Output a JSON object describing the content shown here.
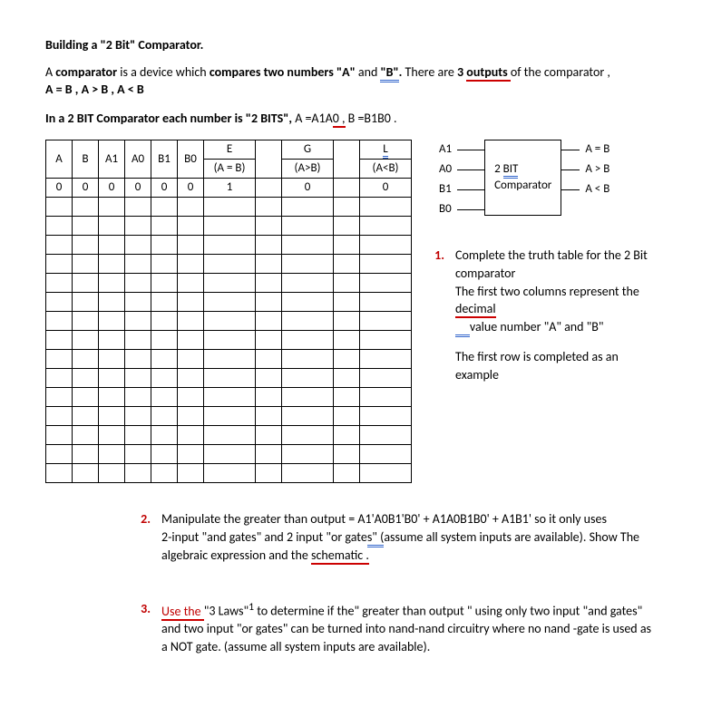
{
  "title": "Building a \"2 Bit\" Comparator.",
  "intro1_a": "A ",
  "intro1_b": "comparator",
  "intro1_c": " is a device which ",
  "intro1_d": "compares two numbers \"A\"",
  "intro1_e": " and ",
  "intro1_f": "\"B\"",
  "intro1_g": ".",
  "intro1_h": "  There are ",
  "intro1_i": "3 ",
  "intro1_j": "outputs ",
  "intro1_k": "of the comparator ,",
  "intro_line2": "A = B ,  A > B , A < B",
  "intro2_a": "In a 2 BIT Comparator each number is \"2 BITS\", ",
  "intro2_b": "A =A1A",
  "intro2_c": "0 ,",
  "intro2_d": " B =B1B0 .",
  "table": {
    "headers_r1": [
      "A",
      "B",
      "A1",
      "A0",
      "B1",
      "B0",
      "E",
      "",
      "G",
      "",
      "L"
    ],
    "headers_r2": [
      "",
      "",
      "",
      "",
      "",
      "",
      "(A = B)",
      "",
      "(A>B)",
      "",
      "(A<B)"
    ],
    "row0": [
      "0",
      "0",
      "0",
      "0",
      "0",
      "0",
      "1",
      "",
      "0",
      "",
      "0"
    ],
    "empty_rows": 15
  },
  "diagram": {
    "inputs": [
      "A1",
      "A0",
      "B1",
      "B0"
    ],
    "box_line1": "2 ",
    "box_line1b": "BIT",
    "box_line2": "Comparator",
    "outputs": [
      "A = B",
      "A > B",
      "A < B"
    ]
  },
  "q1": {
    "num": "1.",
    "line1a": "Complete the truth table for the 2 Bit comparator",
    "line2a": "The first two columns represent the ",
    "line2b": "decimal ",
    "line3a": "value number \"A\" and \"B\"",
    "line4": "The first row is completed as an example"
  },
  "q2": {
    "num": "2.",
    "line1": "Manipulate the greater than output = A1'A0B1'B0' + A1A0B1B0' + A1B1' so it only uses",
    "line2a": "2-input \"and gates\" and 2 input \"or gate",
    "line2b": "s\"   (",
    "line2c": "assume all system inputs are available).  Show The",
    "line3a": "algebraic expression and the ",
    "line3b": "schematic ."
  },
  "q3": {
    "num": "3.",
    "line1a": "Use  the ",
    "line1b": "\"3 Laws\"",
    "line1sup": "1",
    "line1c": " to determine if the\" greater than output \" using only  two input  \"and gates\"  and two input  \"or gates\"  can be turned into nand-nand circuitry where no nand -gate is used as a NOT gate. (assume all system inputs are available)."
  }
}
